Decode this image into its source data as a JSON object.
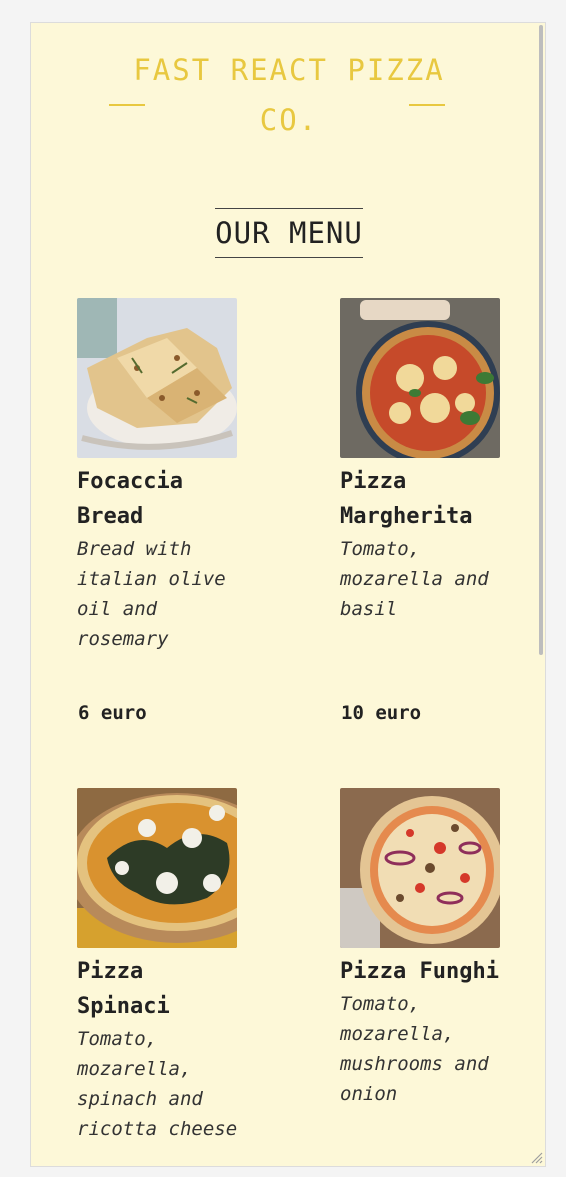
{
  "header": {
    "title": "FAST REACT PIZZA CO."
  },
  "menu": {
    "title": "OUR MENU",
    "items": [
      {
        "name": "Focaccia Bread",
        "ingredients": "Bread with italian olive oil and rosemary",
        "price": "6 euro",
        "photo": "focaccia-photo"
      },
      {
        "name": "Pizza Margherita",
        "ingredients": "Tomato, mozarella and basil",
        "price": "10 euro",
        "photo": "margherita-photo"
      },
      {
        "name": "Pizza Spinaci",
        "ingredients": "Tomato, mozarella, spinach and ricotta cheese",
        "price": "",
        "photo": "spinaci-photo"
      },
      {
        "name": "Pizza Funghi",
        "ingredients": "Tomato, mozarella, mushrooms and onion",
        "price": "",
        "photo": "funghi-photo"
      }
    ]
  },
  "colors": {
    "background": "#fdf8d8",
    "brand": "#e8c840",
    "text": "#222222"
  }
}
